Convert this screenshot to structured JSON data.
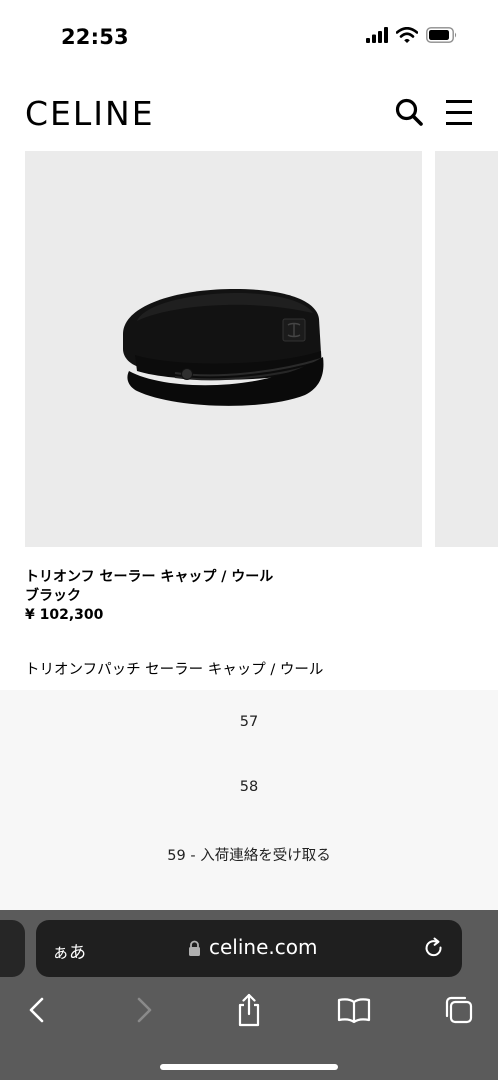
{
  "status_bar": {
    "time": "22:53"
  },
  "header": {
    "logo": "CELINE",
    "search_icon": "search-icon",
    "menu_icon": "hamburger-menu-icon"
  },
  "product": {
    "name": "トリオンフ セーラー キャップ / ウール",
    "color": "ブラック",
    "price": "¥ 102,300",
    "image": "black-wool-sailor-cap"
  },
  "related_product": {
    "name": "トリオンフパッチ セーラー キャップ / ウール"
  },
  "size_options": [
    "57",
    "58",
    "59 - 入荷連絡を受け取る"
  ],
  "browser": {
    "aa_label": "ぁあ",
    "domain": "celine.com",
    "toolbar": [
      "back-icon",
      "forward-icon",
      "share-icon",
      "bookmarks-icon",
      "tabs-icon"
    ]
  },
  "colors": {
    "image_background": "#ebebeb",
    "size_sheet_background": "#f7f7f7",
    "browser_bar": "#5b5b5b",
    "address_bar": "#1f1f1f"
  }
}
